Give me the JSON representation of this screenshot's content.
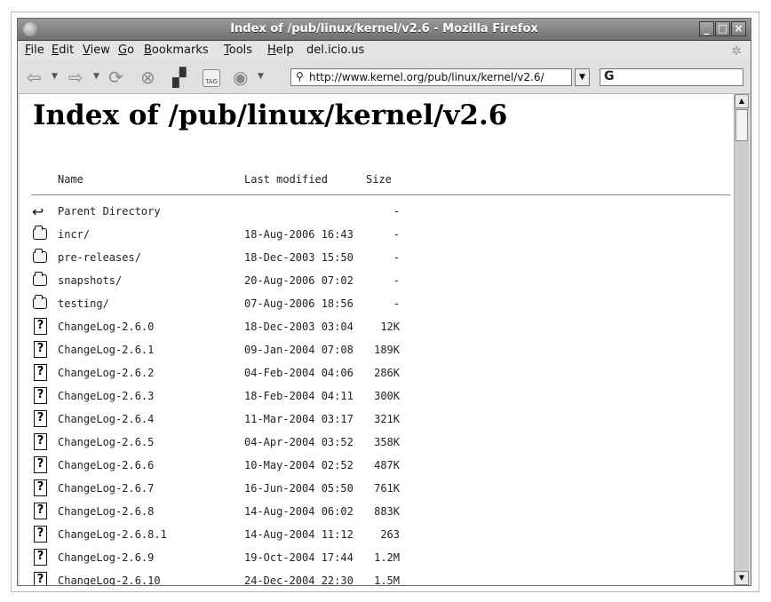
{
  "window": {
    "title": "Index of /pub/linux/kernel/v2.6 - Mozilla Firefox"
  },
  "menu": [
    {
      "key": "F",
      "rest": "ile"
    },
    {
      "key": "E",
      "rest": "dit"
    },
    {
      "key": "V",
      "rest": "iew"
    },
    {
      "key": "G",
      "rest": "o"
    },
    {
      "key": "B",
      "rest": "ookmarks"
    },
    {
      "key": "T",
      "rest": "ools"
    },
    {
      "key": "H",
      "rest": "elp"
    },
    {
      "key": "",
      "rest": "del.icio.us"
    }
  ],
  "toolbar": {
    "tag_label": "TAG"
  },
  "urlbar": {
    "value": "http://www.kernel.org/pub/linux/kernel/v2.6/"
  },
  "search": {
    "engine_glyph": "G"
  },
  "page": {
    "heading": "Index of /pub/linux/kernel/v2.6",
    "columns": {
      "name": "Name",
      "modified": "Last modified",
      "size": "Size"
    },
    "entries": [
      {
        "type": "back",
        "name": "Parent Directory",
        "modified": "",
        "size": "-"
      },
      {
        "type": "folder",
        "name": "incr/",
        "modified": "18-Aug-2006 16:43",
        "size": "-"
      },
      {
        "type": "folder",
        "name": "pre-releases/",
        "modified": "18-Dec-2003 15:50",
        "size": "-"
      },
      {
        "type": "folder",
        "name": "snapshots/",
        "modified": "20-Aug-2006 07:02",
        "size": "-"
      },
      {
        "type": "folder",
        "name": "testing/",
        "modified": "07-Aug-2006 18:56",
        "size": "-"
      },
      {
        "type": "unknown",
        "name": "ChangeLog-2.6.0",
        "modified": "18-Dec-2003 03:04",
        "size": "12K"
      },
      {
        "type": "unknown",
        "name": "ChangeLog-2.6.1",
        "modified": "09-Jan-2004 07:08",
        "size": "189K"
      },
      {
        "type": "unknown",
        "name": "ChangeLog-2.6.2",
        "modified": "04-Feb-2004 04:06",
        "size": "286K"
      },
      {
        "type": "unknown",
        "name": "ChangeLog-2.6.3",
        "modified": "18-Feb-2004 04:11",
        "size": "300K"
      },
      {
        "type": "unknown",
        "name": "ChangeLog-2.6.4",
        "modified": "11-Mar-2004 03:17",
        "size": "321K"
      },
      {
        "type": "unknown",
        "name": "ChangeLog-2.6.5",
        "modified": "04-Apr-2004 03:52",
        "size": "358K"
      },
      {
        "type": "unknown",
        "name": "ChangeLog-2.6.6",
        "modified": "10-May-2004 02:52",
        "size": "487K"
      },
      {
        "type": "unknown",
        "name": "ChangeLog-2.6.7",
        "modified": "16-Jun-2004 05:50",
        "size": "761K"
      },
      {
        "type": "unknown",
        "name": "ChangeLog-2.6.8",
        "modified": "14-Aug-2004 06:02",
        "size": "883K"
      },
      {
        "type": "unknown",
        "name": "ChangeLog-2.6.8.1",
        "modified": "14-Aug-2004 11:12",
        "size": "263"
      },
      {
        "type": "unknown",
        "name": "ChangeLog-2.6.9",
        "modified": "19-Oct-2004 17:44",
        "size": "1.2M"
      },
      {
        "type": "unknown",
        "name": "ChangeLog-2.6.10",
        "modified": "24-Dec-2004 22:30",
        "size": "1.5M"
      }
    ]
  }
}
